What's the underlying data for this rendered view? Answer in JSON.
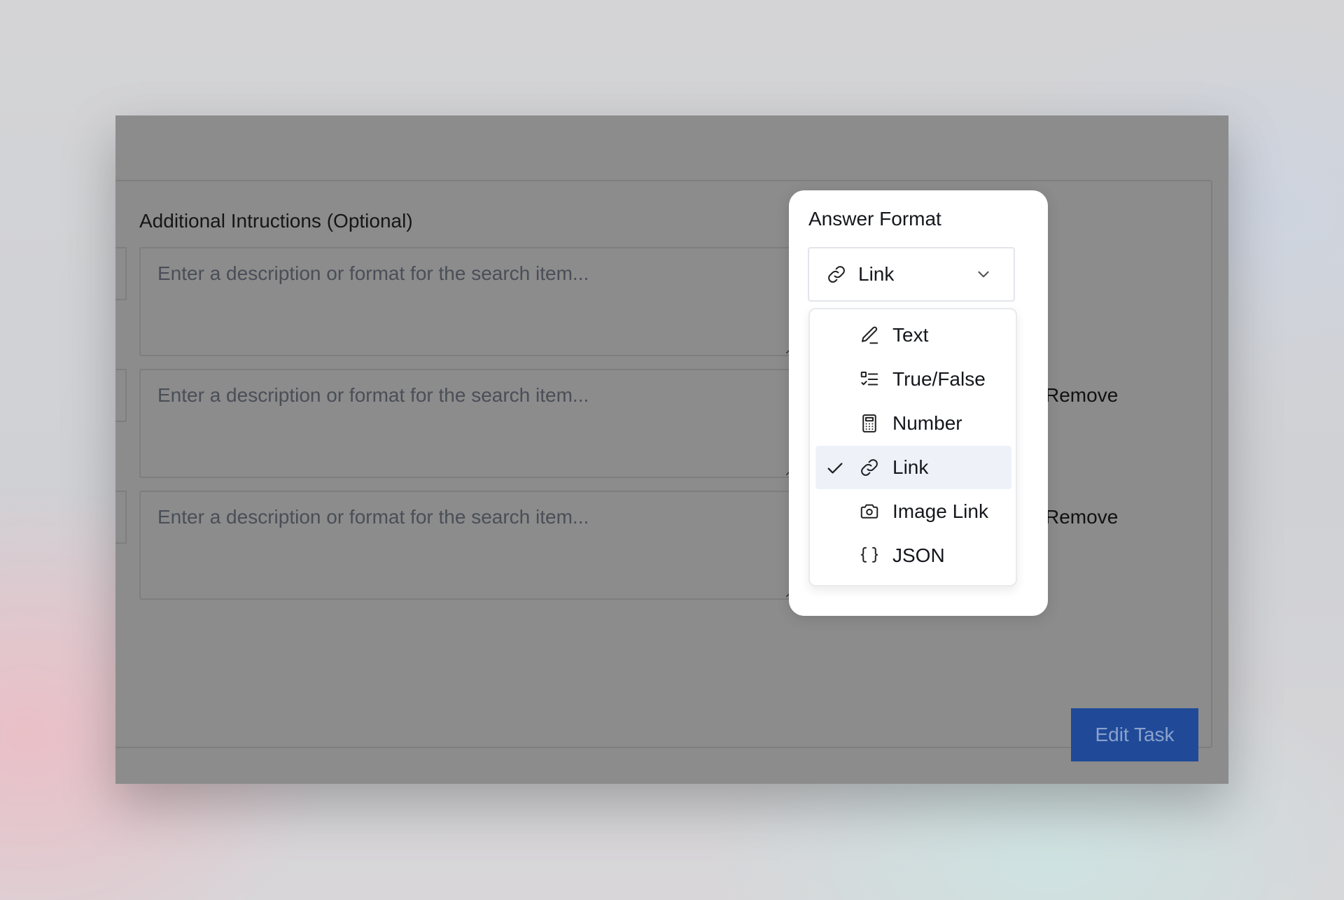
{
  "form": {
    "instructions_label": "Additional Intructions (Optional)",
    "rows": [
      {
        "placeholder": "Enter a description or format for the search item..."
      },
      {
        "placeholder": "Enter a description or format for the search item...",
        "remove_label": "Remove"
      },
      {
        "placeholder": "Enter a description or format for the search item...",
        "remove_label": "Remove"
      }
    ],
    "submit_label": "Edit Task"
  },
  "answer_format": {
    "title": "Answer Format",
    "selected": {
      "label": "Link",
      "icon": "link-icon"
    },
    "options": [
      {
        "label": "Text",
        "icon": "pencil-icon",
        "selected": false
      },
      {
        "label": "True/False",
        "icon": "checklist-icon",
        "selected": false
      },
      {
        "label": "Number",
        "icon": "calculator-icon",
        "selected": false
      },
      {
        "label": "Link",
        "icon": "link-icon",
        "selected": true
      },
      {
        "label": "Image Link",
        "icon": "camera-icon",
        "selected": false
      },
      {
        "label": "JSON",
        "icon": "braces-icon",
        "selected": false
      }
    ]
  },
  "colors": {
    "overlay": "#8c8c8c",
    "primary_button": "#204a98",
    "selected_option_bg": "#eef2f8"
  }
}
